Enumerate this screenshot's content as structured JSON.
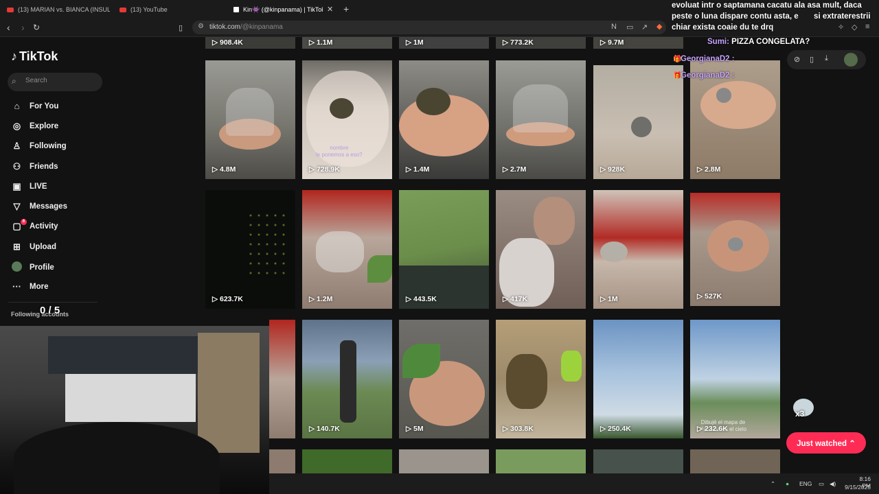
{
  "browser": {
    "tabs": [
      {
        "title": "(13) MARIAN vs. BIANCA (INSULA IU"
      },
      {
        "title": "(13) YouTube"
      },
      {
        "title": "Kin👾 (@kinpanama) | TikTok"
      }
    ],
    "url_host": "tiktok.com",
    "url_path": "/@kinpanama"
  },
  "sidebar": {
    "logo": "TikTok",
    "search_placeholder": "Search",
    "items": [
      {
        "label": "For You",
        "icon": "home-icon"
      },
      {
        "label": "Explore",
        "icon": "compass-icon"
      },
      {
        "label": "Following",
        "icon": "following-icon"
      },
      {
        "label": "Friends",
        "icon": "friends-icon"
      },
      {
        "label": "LIVE",
        "icon": "live-icon"
      },
      {
        "label": "Messages",
        "icon": "messages-icon"
      },
      {
        "label": "Activity",
        "icon": "activity-icon",
        "badge": "6"
      },
      {
        "label": "Upload",
        "icon": "upload-icon"
      },
      {
        "label": "Profile",
        "icon": "profile-icon"
      },
      {
        "label": "More",
        "icon": "more-icon"
      }
    ],
    "following_accounts": "Following accounts"
  },
  "overlay": {
    "score": "0 / 5",
    "chat_top": "evoluat intr o saptamana cacatu ala asa mult, daca peste o luna dispare contu asta, e       si extraterestrii chiar exista coaie du te drq",
    "chat_lines": [
      {
        "user": "Sumi",
        "text": "PIZZA CONGELATA?"
      },
      {
        "user": "GeorgianaD2",
        "text": ""
      },
      {
        "user": "GeorgianaD2",
        "text": ""
      }
    ],
    "mascot_count": "x3"
  },
  "videos_partial_top": [
    "908.4K",
    "1.1M",
    "1M",
    "773.2K",
    "9.7M"
  ],
  "videos": [
    {
      "views": "4.8M"
    },
    {
      "views": "728.9K",
      "caption": "nombre\nle ponemos a eso?"
    },
    {
      "views": "1.4M"
    },
    {
      "views": "2.7M"
    },
    {
      "views": "928K"
    },
    {
      "views": "2.8M"
    },
    {
      "views": "623.7K"
    },
    {
      "views": "1.2M"
    },
    {
      "views": "443.5K"
    },
    {
      "views": "417K"
    },
    {
      "views": "1M"
    },
    {
      "views": "527K"
    },
    {
      "views": "140.7K"
    },
    {
      "views": "140.7K"
    },
    {
      "views": "5M"
    },
    {
      "views": "303.8K"
    },
    {
      "views": "250.4K"
    },
    {
      "views": "232.6K",
      "caption": "Dibujé el mapa de\nPanamá en el cielo"
    }
  ],
  "just_watched": "Just watched",
  "taskbar": {
    "lang": "ENG",
    "time": "8:16 PM",
    "date": "9/15/2025"
  },
  "colors": {
    "accent": "#fe2c55",
    "bg": "#121212"
  }
}
